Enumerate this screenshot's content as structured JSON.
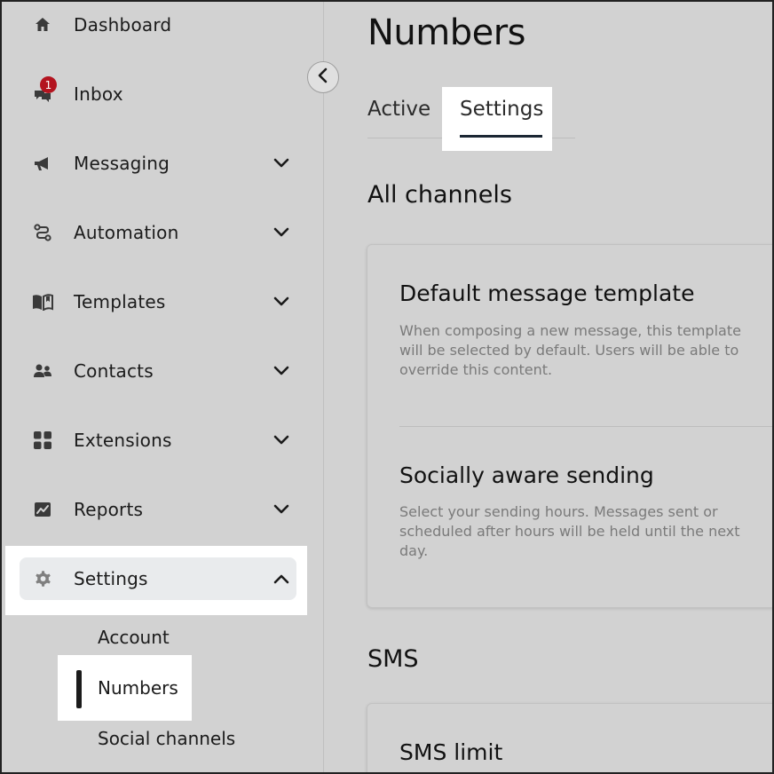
{
  "sidebar": {
    "items": [
      {
        "label": "Dashboard",
        "icon": "home-icon"
      },
      {
        "label": "Inbox",
        "icon": "inbox-icon",
        "badge": "1"
      },
      {
        "label": "Messaging",
        "icon": "megaphone-icon"
      },
      {
        "label": "Automation",
        "icon": "automation-icon"
      },
      {
        "label": "Templates",
        "icon": "book-icon"
      },
      {
        "label": "Contacts",
        "icon": "contacts-icon"
      },
      {
        "label": "Extensions",
        "icon": "grid-icon"
      },
      {
        "label": "Reports",
        "icon": "chart-icon"
      },
      {
        "label": "Settings",
        "icon": "gear-icon"
      }
    ],
    "sub_items": [
      "Account",
      "Numbers",
      "Social channels"
    ],
    "active_item": "Settings",
    "active_sub_item": "Numbers"
  },
  "main": {
    "title": "Numbers",
    "tabs": [
      "Active",
      "Settings"
    ],
    "active_tab": "Settings",
    "sections": [
      {
        "title": "All channels",
        "cards": [
          {
            "title": "Default message template",
            "desc": "When composing a new message, this template will be selected by default. Users will be able to override this content."
          },
          {
            "title": "Socially aware sending",
            "desc": "Select your sending hours. Messages sent or scheduled after hours will be held until the next day."
          }
        ]
      },
      {
        "title": "SMS",
        "cards": [
          {
            "title": "SMS limit"
          }
        ]
      }
    ]
  },
  "colors": {
    "background": "#d2d2d2",
    "badge": "#b3141f",
    "active_bg": "#e9ebed",
    "highlight": "#ffffff",
    "muted_text": "#7a7a7a"
  }
}
